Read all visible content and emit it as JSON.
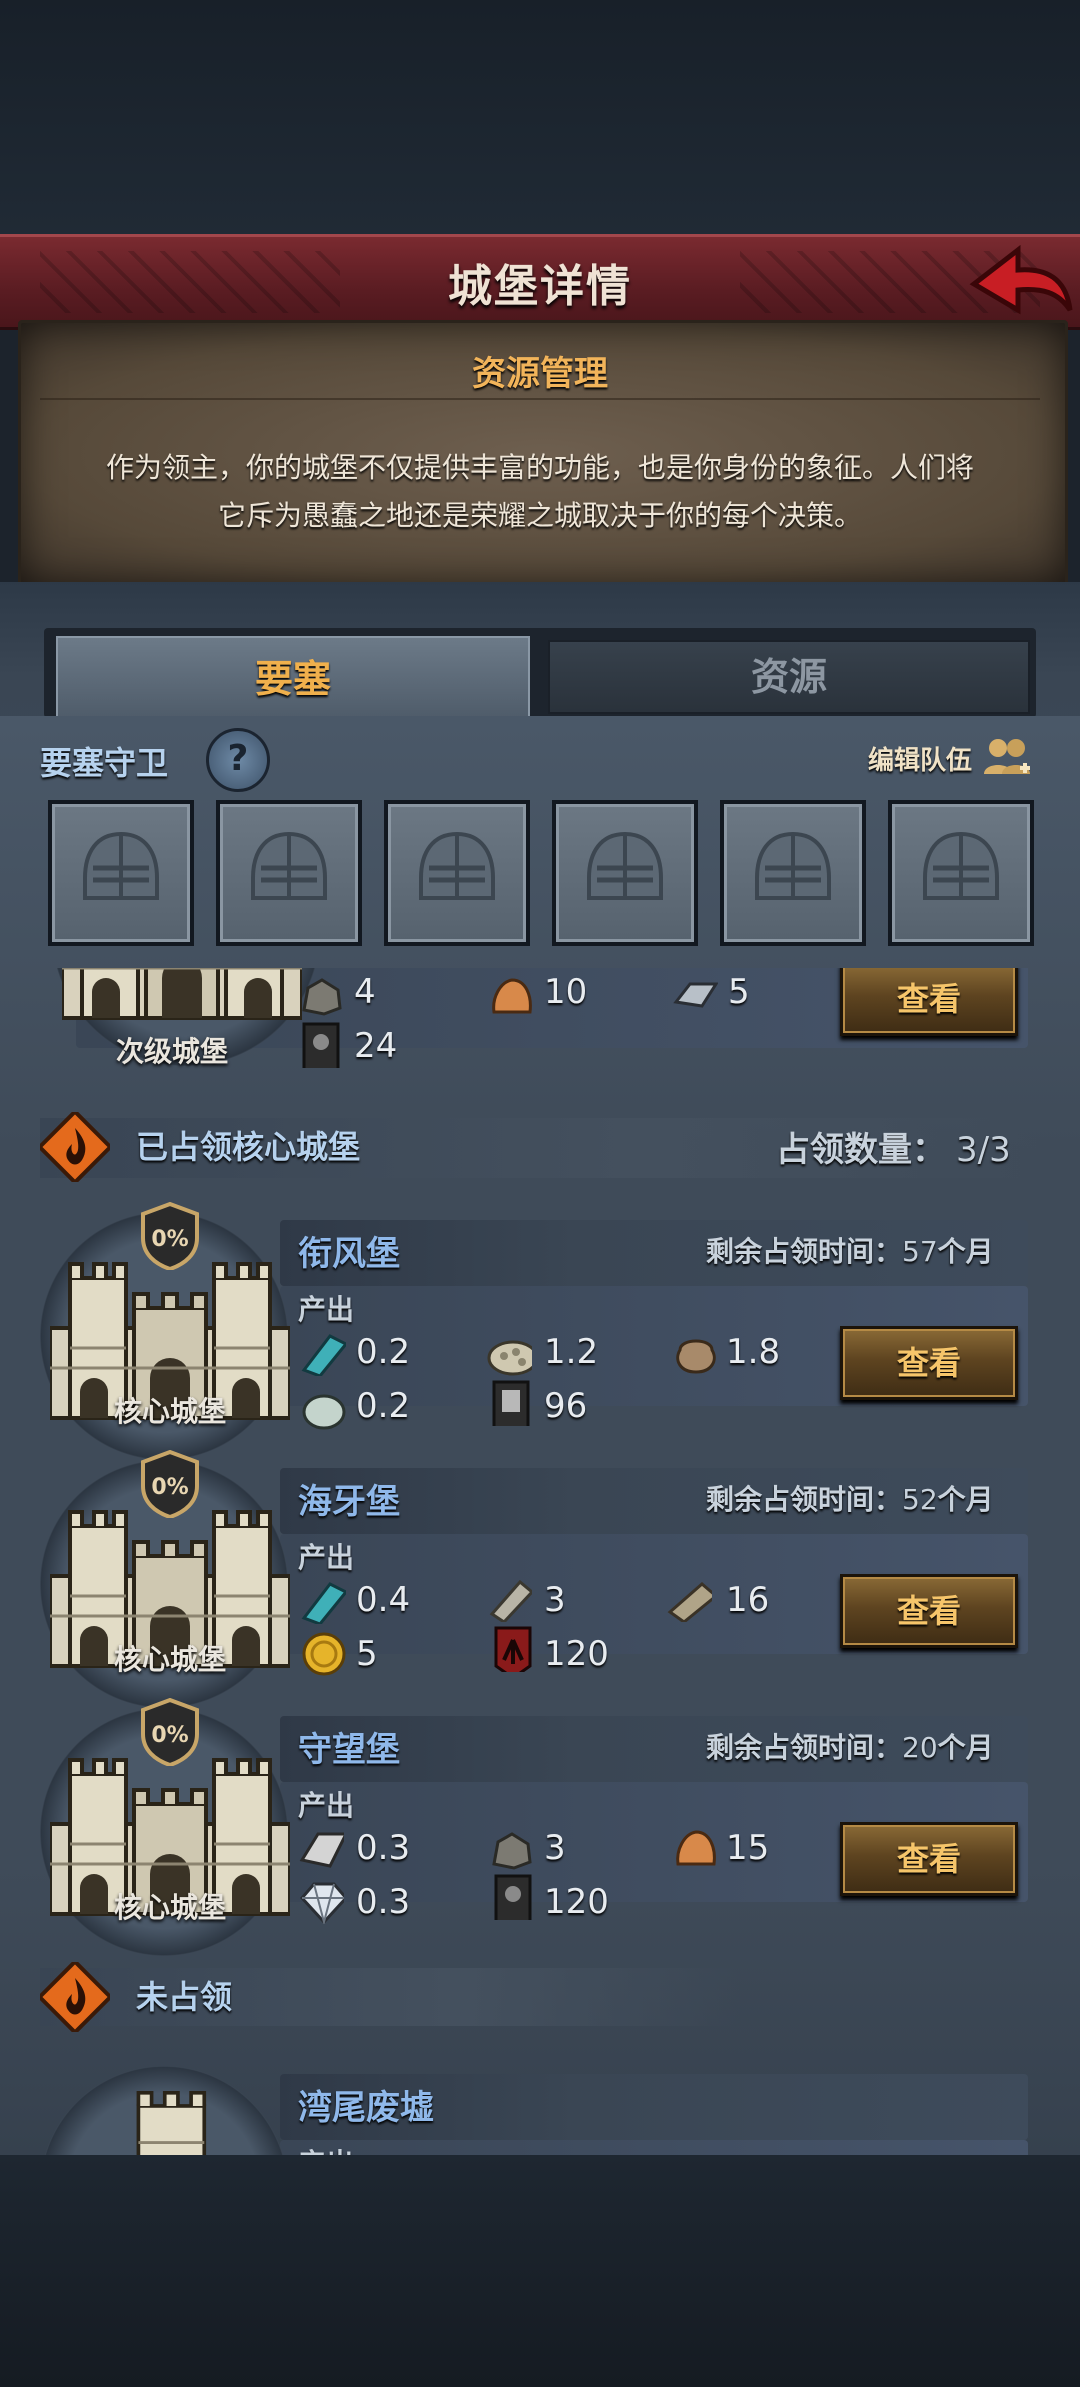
{
  "header": {
    "title": "城堡详情"
  },
  "intro": {
    "title": "资源管理",
    "line1": "作为领主，你的城堡不仅提供丰富的功能，也是你身份的象征。人们将",
    "line2": "它斥为愚蠢之地还是荣耀之城取决于你的每个决策。"
  },
  "tabs": [
    {
      "label": "要塞",
      "active": true
    },
    {
      "label": "资源",
      "active": false
    }
  ],
  "guard": {
    "label": "要塞守卫",
    "edit_label": "编辑队伍",
    "slots": 6
  },
  "partial_castle": {
    "caption": "次级城堡",
    "resources": [
      {
        "icon": "stone-icon",
        "value": "4"
      },
      {
        "icon": "copper-ore-icon",
        "value": "10"
      },
      {
        "icon": "iron-ingot-icon",
        "value": "5"
      },
      {
        "icon": "soldier-card-icon",
        "value": "24"
      }
    ],
    "view_label": "查看"
  },
  "occupied_section": {
    "title": "已占领核心城堡",
    "count_label": "占领数量：",
    "count_value": "3/3"
  },
  "castles": [
    {
      "name": "衔风堡",
      "remain_label": "剩余占领时间：",
      "remain_num": "57",
      "remain_unit": "个月",
      "produce_label": "产出",
      "caption": "核心城堡",
      "percent": "0%",
      "resources": [
        {
          "icon": "cloth-icon",
          "value": "0.2"
        },
        {
          "icon": "grain-icon",
          "value": "1.2"
        },
        {
          "icon": "sack-icon",
          "value": "1.8"
        },
        {
          "icon": "egg-icon",
          "value": "0.2"
        },
        {
          "icon": "knight-card-icon",
          "value": "96"
        }
      ],
      "view_label": "查看"
    },
    {
      "name": "海牙堡",
      "remain_label": "剩余占领时间：",
      "remain_num": "52",
      "remain_unit": "个月",
      "produce_label": "产出",
      "caption": "核心城堡",
      "percent": "0%",
      "resources": [
        {
          "icon": "cloth-icon",
          "value": "0.4"
        },
        {
          "icon": "scroll-icon",
          "value": "3"
        },
        {
          "icon": "leather-roll-icon",
          "value": "16"
        },
        {
          "icon": "gold-coin-icon",
          "value": "5"
        },
        {
          "icon": "red-banner-icon",
          "value": "120"
        }
      ],
      "view_label": "查看"
    },
    {
      "name": "守望堡",
      "remain_label": "剩余占领时间：",
      "remain_num": "20",
      "remain_unit": "个月",
      "produce_label": "产出",
      "caption": "核心城堡",
      "percent": "0%",
      "resources": [
        {
          "icon": "silver-ingot-icon",
          "value": "0.3"
        },
        {
          "icon": "stone-icon",
          "value": "3"
        },
        {
          "icon": "copper-ore-icon",
          "value": "15"
        },
        {
          "icon": "diamond-icon",
          "value": "0.3"
        },
        {
          "icon": "soldier-card-icon",
          "value": "120"
        }
      ],
      "view_label": "查看"
    }
  ],
  "unoccupied_section": {
    "title": "未占领"
  },
  "unoccupied_castles": [
    {
      "name": "湾尾废墟",
      "produce_label": "产出"
    }
  ],
  "colors": {
    "accent_gold": "#f2b45a",
    "title_bar": "#6a2228",
    "name_blue": "#8fb8ea"
  }
}
